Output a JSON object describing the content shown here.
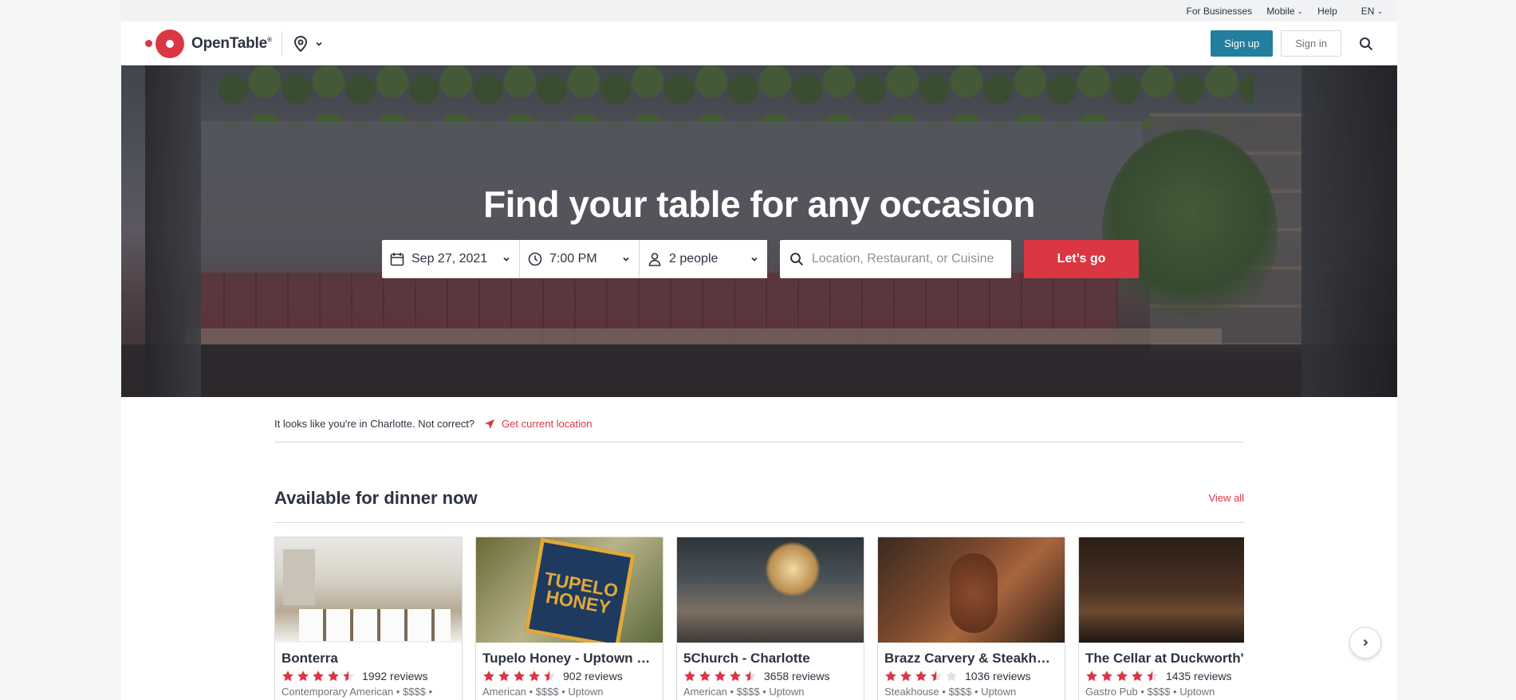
{
  "util_bar": {
    "for_businesses": "For Businesses",
    "mobile": "Mobile",
    "help": "Help",
    "language": "EN"
  },
  "header": {
    "logo_text": "OpenTable",
    "logo_reg": "®",
    "signup_label": "Sign up",
    "signin_label": "Sign in"
  },
  "hero": {
    "title": "Find your table for any occasion",
    "date": "Sep 27, 2021",
    "time": "7:00 PM",
    "party": "2 people",
    "search_placeholder": "Location, Restaurant, or Cuisine",
    "go_label": "Let’s go"
  },
  "location": {
    "message": "It looks like you're in Charlotte. Not correct?",
    "get_location": "Get current location"
  },
  "section": {
    "title": "Available for dinner now",
    "view_all": "View all"
  },
  "cards": [
    {
      "name": "Bonterra",
      "rating": 4.5,
      "reviews": "1992 reviews",
      "meta": "Contemporary American • $$$$ • "
    },
    {
      "name": "Tupelo Honey - Uptown C...",
      "rating": 4.5,
      "reviews": "902 reviews",
      "meta": "American • $$$$ • Uptown",
      "sign_top": "TUPELO",
      "sign_bottom": "HONEY"
    },
    {
      "name": "5Church - Charlotte",
      "rating": 4.5,
      "reviews": "3658 reviews",
      "meta": "American • $$$$ • Uptown"
    },
    {
      "name": "Brazz Carvery & Steakhouse",
      "rating": 3.5,
      "reviews": "1036 reviews",
      "meta": "Steakhouse • $$$$ • Uptown"
    },
    {
      "name": "The Cellar at Duckworth's",
      "rating": 4.5,
      "reviews": "1435 reviews",
      "meta": "Gastro Pub • $$$$ • Uptown"
    }
  ],
  "colors": {
    "brand_red": "#da3743",
    "signup_blue": "#247f9e",
    "text": "#2d333f"
  }
}
